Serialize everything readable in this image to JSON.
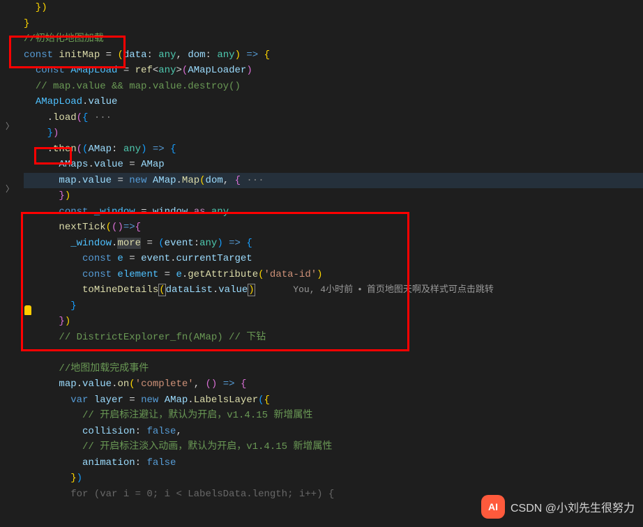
{
  "lines": {
    "l1": "  })",
    "l2": "}",
    "l3_comment": "//初始化地图加载",
    "l4_const": "const",
    "l4_name": " initMap ",
    "l4_eq": "= ",
    "l4_paren_open": "(",
    "l4_p1": "data",
    "l4_colon": ": ",
    "l4_any": "any",
    "l4_comma": ", ",
    "l4_p2": "dom",
    "l4_paren_close": ")",
    "l4_arrow": " => ",
    "l4_brace": "{",
    "l5_const": "const",
    "l5_name": " AMapLoad ",
    "l5_eq": "= ",
    "l5_ref": "ref",
    "l5_lt": "<",
    "l5_any": "any",
    "l5_gt": ">",
    "l5_po": "(",
    "l5_arg": "AMapLoader",
    "l5_pc": ")",
    "l6_comment": "// map.value && map.value.destroy()",
    "l7_obj": "AMapLoad",
    "l7_dot": ".",
    "l7_prop": "value",
    "l8_dot": ".",
    "l8_load": "load",
    "l8_po": "(",
    "l8_bo": "{",
    "l8_dots": " ···",
    "l9_bc": "}",
    "l9_pc": ")",
    "l10_dot": ".",
    "l10_then": "then",
    "l10_po": "(",
    "l10_ppo": "(",
    "l10_p": "AMap",
    "l10_colon": ": ",
    "l10_any": "any",
    "l10_ppc": ")",
    "l10_arrow": " => ",
    "l10_bo": "{",
    "l11_a": "AMaps",
    "l11_dot": ".",
    "l11_v": "value",
    "l11_eq": " = ",
    "l11_b": "AMap",
    "l12_a": "map",
    "l12_dot": ".",
    "l12_v": "value",
    "l12_eq": " = ",
    "l12_new": "new",
    "l12_sp": " ",
    "l12_cls": "AMap",
    "l12_dot2": ".",
    "l12_m": "Map",
    "l12_po": "(",
    "l12_arg": "dom",
    "l12_comma": ", ",
    "l12_bo": "{",
    "l12_dots": " ···",
    "l13_bc": "}",
    "l13_pc": ")",
    "l14_const": "const",
    "l14_name": " _window ",
    "l14_eq": "= ",
    "l14_win": "window",
    "l14_as": " as ",
    "l14_any": "any",
    "l15_fn": "nextTick",
    "l15_po": "(",
    "l15_ppo": "(",
    "l15_ppc": ")",
    "l15_arrow": "=>",
    "l15_bo": "{",
    "l16_a": "_window",
    "l16_dot": ".",
    "l16_more": "more",
    "l16_eq": " = ",
    "l16_po": "(",
    "l16_p": "event",
    "l16_colon": ":",
    "l16_any": "any",
    "l16_pc": ")",
    "l16_arrow": " => ",
    "l16_bo": "{",
    "l17_const": "const",
    "l17_name": " e ",
    "l17_eq": "= ",
    "l17_ev": "event",
    "l17_dot": ".",
    "l17_ct": "currentTarget",
    "l18_const": "const",
    "l18_name": " element ",
    "l18_eq": "= ",
    "l18_e": "e",
    "l18_dot": ".",
    "l18_ga": "getAttribute",
    "l18_po": "(",
    "l18_str": "'data-id'",
    "l18_pc": ")",
    "l19_fn": "toMineDetails",
    "l19_po": "(",
    "l19_dl": "dataList",
    "l19_dot": ".",
    "l19_v": "value",
    "l19_pc": ")",
    "l19_blame": "You, 4小时前",
    "l19_blame2": "首页地图天啊及样式可点击跳转",
    "l20_bc": "}",
    "l21_bc": "}",
    "l21_pc": ")",
    "l22_comment": "// DistrictExplorer_fn(AMap) // 下钻",
    "l24_comment": "//地图加载完成事件",
    "l25_a": "map",
    "l25_dot": ".",
    "l25_v": "value",
    "l25_dot2": ".",
    "l25_on": "on",
    "l25_po": "(",
    "l25_str": "'complete'",
    "l25_comma": ", ",
    "l25_ppo": "(",
    "l25_ppc": ")",
    "l25_arrow": " => ",
    "l25_bo": "{",
    "l26_var": "var",
    "l26_name": " layer ",
    "l26_eq": "= ",
    "l26_new": "new",
    "l26_sp": " ",
    "l26_cls": "AMap",
    "l26_dot": ".",
    "l26_ll": "LabelsLayer",
    "l26_po": "(",
    "l26_bo": "{",
    "l27_comment": "// 开启标注避让，默认为开启，v1.4.15 新增属性",
    "l28_k": "collision",
    "l28_colon": ": ",
    "l28_v": "false",
    "l28_comma": ",",
    "l29_comment": "// 开启标注淡入动画，默认为开启，v1.4.15 新增属性",
    "l30_k": "animation",
    "l30_colon": ": ",
    "l30_v": "false",
    "l31_bc": "}",
    "l31_pc": ")",
    "l32_partial": "for (var i = 0; i < LabelsData.length; i++) {"
  },
  "watermark": "CSDN @小刘先生很努力",
  "ai_badge": "AI"
}
